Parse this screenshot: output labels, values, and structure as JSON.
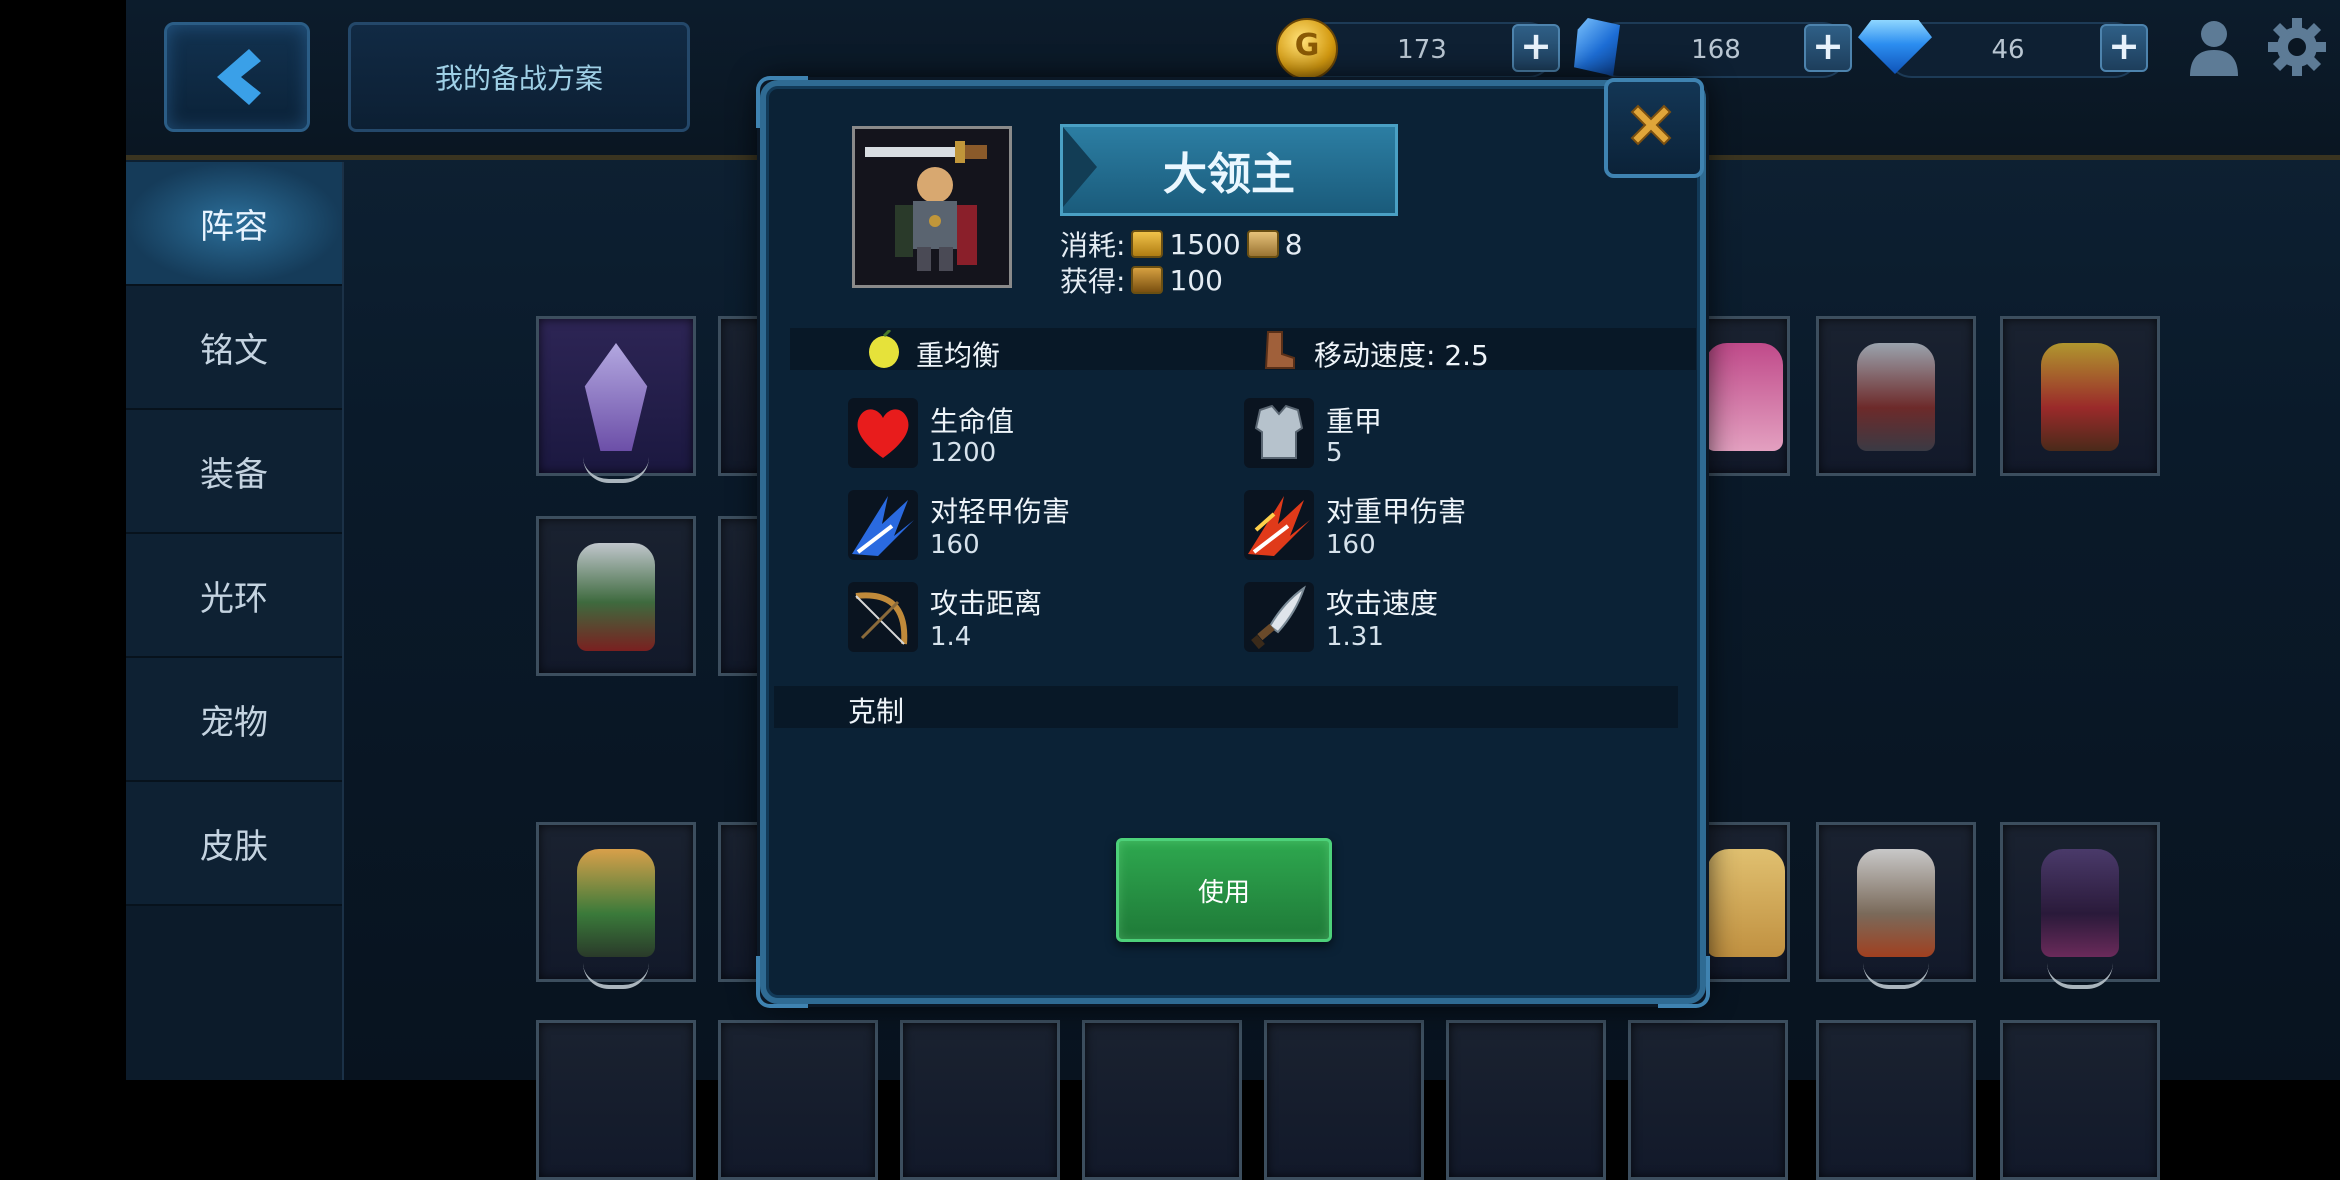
{
  "header": {
    "plan_label": "我的备战方案",
    "gold": "173",
    "crystal": "168",
    "diamond": "46",
    "plus": "+"
  },
  "sidebar": {
    "items": [
      {
        "label": "阵容",
        "active": true
      },
      {
        "label": "铭文"
      },
      {
        "label": "装备"
      },
      {
        "label": "光环"
      },
      {
        "label": "宠物"
      },
      {
        "label": "皮肤"
      }
    ]
  },
  "dialog": {
    "name": "大领主",
    "cost_label": "消耗:",
    "cost_gold": "1500",
    "cost_pop": "8",
    "gain_label": "获得:",
    "gain_value": "100",
    "type": "重均衡",
    "move_speed": "移动速度: 2.5",
    "stats": {
      "hp_label": "生命值",
      "hp_value": "1200",
      "armor_label": "重甲",
      "armor_value": "5",
      "vs_light_label": "对轻甲伤害",
      "vs_light_value": "160",
      "vs_heavy_label": "对重甲伤害",
      "vs_heavy_value": "160",
      "range_label": "攻击距离",
      "range_value": "1.4",
      "atk_speed_label": "攻击速度",
      "atk_speed_value": "1.31"
    },
    "counter_label": "克制",
    "use_label": "使用"
  },
  "colors": {
    "accent_blue": "#2f6b93",
    "use_green": "#2ea84f",
    "gold": "#d49a10"
  },
  "icons": [
    "back-arrow-icon",
    "coin-icon",
    "crystal-icon",
    "diamond-icon",
    "profile-icon",
    "settings-icon",
    "close-icon",
    "heart-icon",
    "armor-icon",
    "blue-slash-icon",
    "red-slash-icon",
    "bow-icon",
    "dagger-icon",
    "lemon-icon",
    "boot-icon"
  ]
}
